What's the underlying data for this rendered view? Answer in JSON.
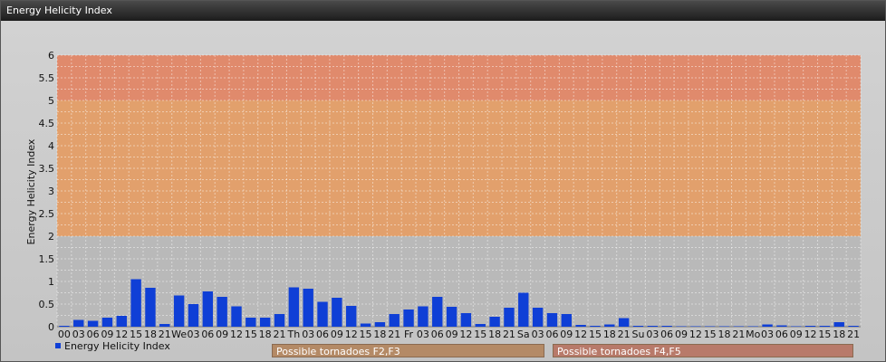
{
  "window": {
    "title": "Energy Helicity Index"
  },
  "legend": {
    "label": "Energy Helicity Index"
  },
  "zones": [
    {
      "label": "Possible tornadoes F2,F3",
      "from": 2,
      "to": 5,
      "color": "#e2a06c"
    },
    {
      "label": "Possible tornadoes F4,F5",
      "from": 5,
      "to": 6,
      "color": "#e08a6c"
    }
  ],
  "chart_data": {
    "type": "bar",
    "ylabel": "Energy Helicity Index",
    "ylim": [
      0,
      6
    ],
    "yticks": [
      "0",
      "0.5",
      "1",
      "1.5",
      "2",
      "2.5",
      "3",
      "3.5",
      "4",
      "4.5",
      "5",
      "5.5",
      "6"
    ],
    "grid": true,
    "categories": [
      "00",
      "03",
      "06",
      "09",
      "12",
      "15",
      "18",
      "21",
      "We",
      "03",
      "06",
      "09",
      "12",
      "15",
      "18",
      "21",
      "Th",
      "03",
      "06",
      "09",
      "12",
      "15",
      "18",
      "21",
      "Fr",
      "03",
      "06",
      "09",
      "12",
      "15",
      "18",
      "21",
      "Sa",
      "03",
      "06",
      "09",
      "12",
      "15",
      "18",
      "21",
      "Su",
      "03",
      "06",
      "09",
      "12",
      "15",
      "18",
      "21",
      "Mo",
      "03",
      "06",
      "09",
      "12",
      "15",
      "18",
      "21"
    ],
    "series": [
      {
        "name": "Energy Helicity Index",
        "color": "#0f3fd6",
        "values": [
          0.02,
          0.15,
          0.13,
          0.2,
          0.24,
          1.05,
          0.86,
          0.06,
          0.69,
          0.5,
          0.78,
          0.66,
          0.45,
          0.2,
          0.2,
          0.28,
          0.87,
          0.84,
          0.55,
          0.64,
          0.46,
          0.07,
          0.1,
          0.28,
          0.38,
          0.45,
          0.66,
          0.44,
          0.3,
          0.06,
          0.22,
          0.42,
          0.75,
          0.42,
          0.3,
          0.28,
          0.04,
          0.02,
          0.05,
          0.19,
          0.02,
          0.02,
          0.02,
          0.01,
          0.01,
          0.01,
          0.01,
          0.01,
          0.01,
          0.05,
          0.03,
          0.01,
          0.02,
          0.02,
          0.1,
          0.02
        ]
      }
    ]
  }
}
